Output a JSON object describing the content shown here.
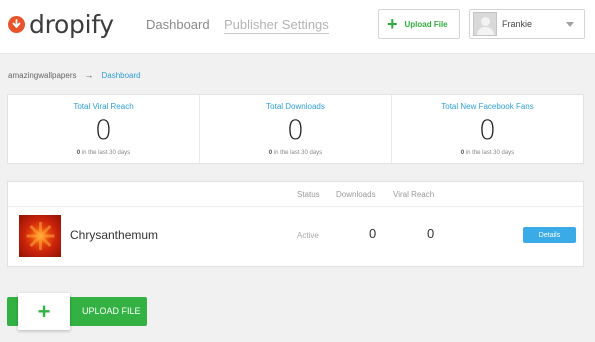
{
  "header": {
    "logo_text": "dropify",
    "nav": {
      "dashboard": "Dashboard",
      "publisher_settings": "Publisher Settings"
    },
    "upload_button": {
      "icon": "plus-icon",
      "label": "Upload File"
    },
    "user": {
      "name": "Frankie"
    }
  },
  "breadcrumb": {
    "root": "amazingwallpapers",
    "current": "Dashboard"
  },
  "stats": [
    {
      "title": "Total Viral Reach",
      "value": "0",
      "sub_count": "0",
      "sub_text": " in the last 30 days"
    },
    {
      "title": "Total Downloads",
      "value": "0",
      "sub_count": "0",
      "sub_text": " in the last 30 days"
    },
    {
      "title": "Total New Facebook Fans",
      "value": "0",
      "sub_count": "0",
      "sub_text": " in the last 30 days"
    }
  ],
  "table": {
    "columns": {
      "status": "Status",
      "downloads": "Downloads",
      "viral_reach": "Viral Reach"
    },
    "rows": [
      {
        "name": "Chrysanthemum",
        "status": "Active",
        "downloads": "0",
        "viral_reach": "0",
        "action": "Details"
      }
    ]
  },
  "upload_big": {
    "icon": "plus-icon",
    "plus": "+",
    "label": "UPLOAD FILE"
  },
  "colors": {
    "accent_blue": "#2f9fd8",
    "green": "#33b243",
    "logo_red": "#e8542c"
  }
}
